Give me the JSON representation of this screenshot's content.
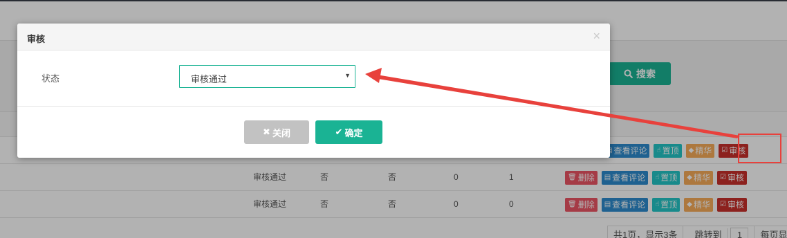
{
  "background": {
    "search_button": {
      "label": "搜索",
      "icon": "search-icon"
    },
    "rows": [
      {
        "status": "",
        "col2": "",
        "col3": "",
        "col4": "",
        "col5": ""
      },
      {
        "status": "审核通过",
        "col2": "否",
        "col3": "否",
        "col4": "0",
        "col5": "1"
      },
      {
        "status": "审核通过",
        "col2": "否",
        "col3": "否",
        "col4": "0",
        "col5": "0"
      }
    ],
    "actions": {
      "delete": "删除",
      "view_comments": "查看评论",
      "pin": "置顶",
      "feature": "精华",
      "audit": "审核"
    },
    "pager": {
      "summary": "共1页，显示3条",
      "jump_label": "跳转到",
      "jump_value": "1",
      "per_page_label": "每页显"
    }
  },
  "modal": {
    "title": "审核",
    "close_glyph": "×",
    "field_label": "状态",
    "select_value": "审核通过",
    "cancel_label": "关闭",
    "confirm_label": "确定"
  },
  "colors": {
    "primary": "#1ab394",
    "danger": "#ed5565",
    "info": "#2d8ccf",
    "teal": "#23c6c8",
    "warning": "#f8ac59",
    "audit": "#c9302c",
    "annotation": "#e8413c"
  }
}
